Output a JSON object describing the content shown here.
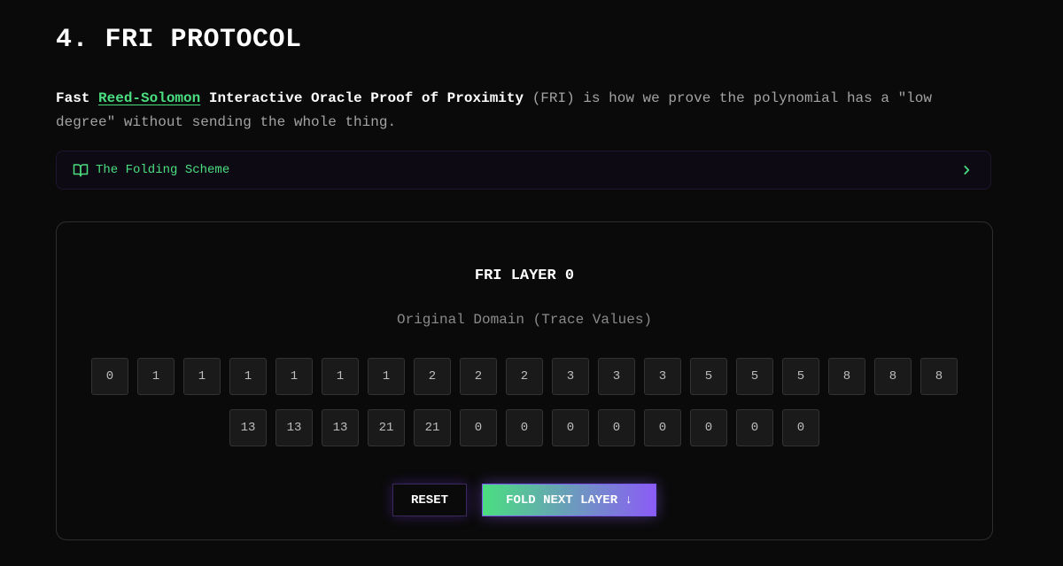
{
  "section": {
    "title": "4. FRI PROTOCOL"
  },
  "intro": {
    "part1": "Fast ",
    "link": "Reed-Solomon",
    "part2": " Interactive Oracle Proof of Proximity",
    "part3": " (FRI) is how we prove the polynomial has a \"low degree\" without sending the whole thing."
  },
  "accordion": {
    "label": "The Folding Scheme",
    "icon": "book-icon",
    "chevron": "chevron-right-icon"
  },
  "panel": {
    "title": "FRI LAYER 0",
    "subtitle": "Original Domain (Trace Values)",
    "row1": [
      "0",
      "1",
      "1",
      "1",
      "1",
      "1",
      "1",
      "2",
      "2",
      "2",
      "3",
      "3",
      "3",
      "5",
      "5",
      "5",
      "8",
      "8",
      "8"
    ],
    "row2": [
      "13",
      "13",
      "13",
      "21",
      "21",
      "0",
      "0",
      "0",
      "0",
      "0",
      "0",
      "0",
      "0"
    ]
  },
  "buttons": {
    "reset": "RESET",
    "fold": "FOLD NEXT LAYER ↓"
  },
  "colors": {
    "accent_green": "#4ade80",
    "accent_purple": "#8b5cf6",
    "background": "#0a0a0a"
  }
}
